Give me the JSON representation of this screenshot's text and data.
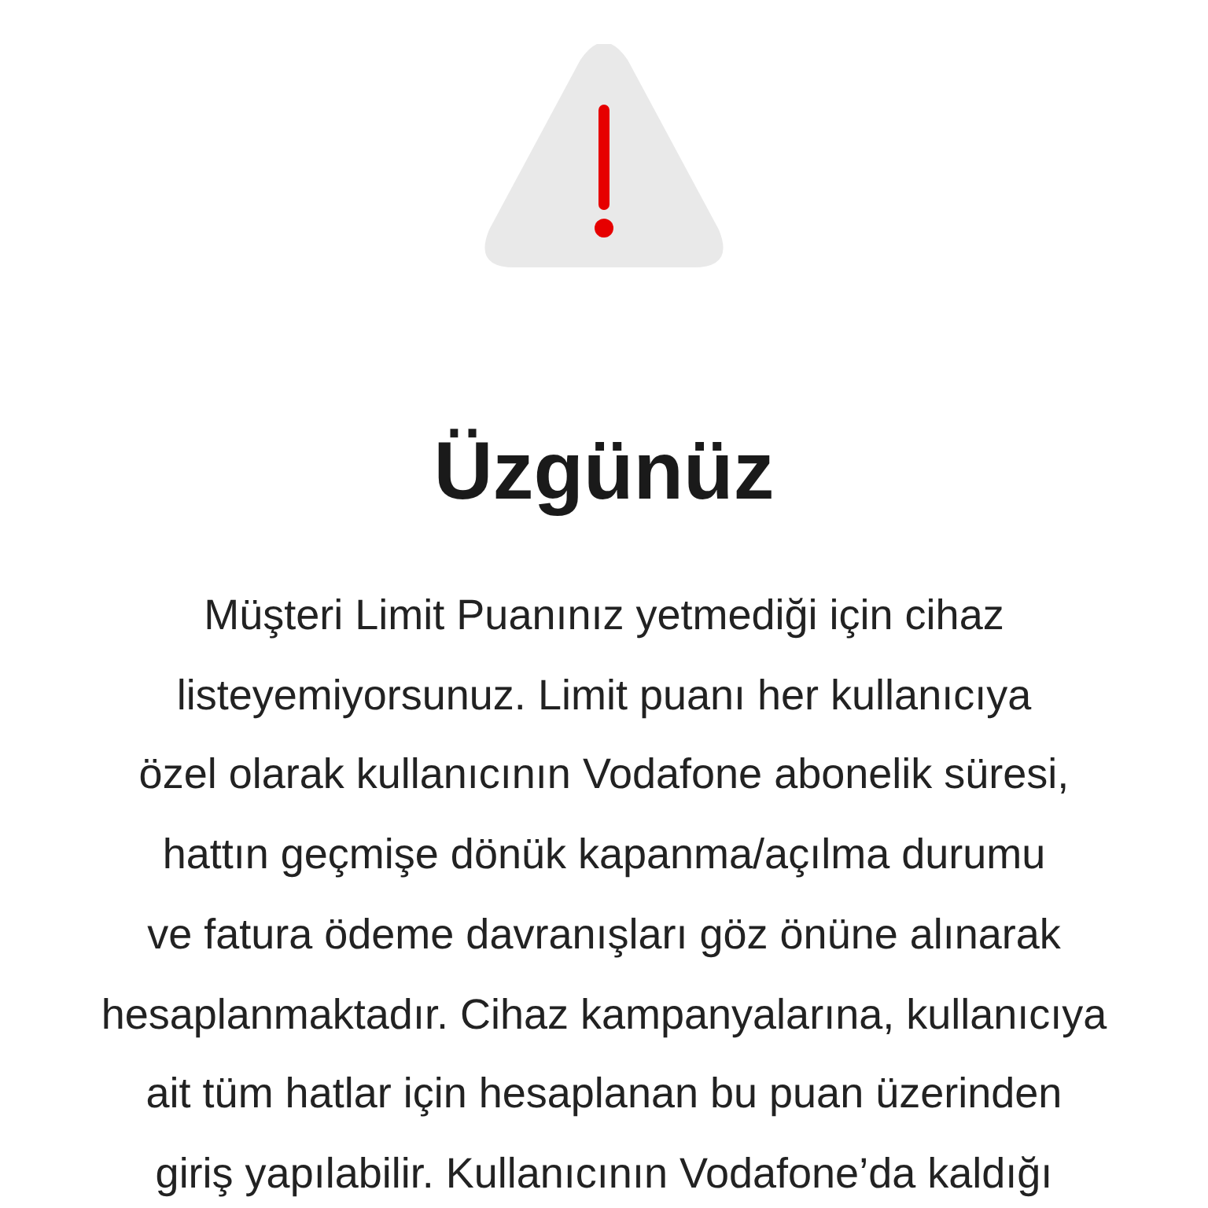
{
  "alert": {
    "title": "Üzgünüz",
    "message_lines": [
      "Müşteri Limit Puanınız yetmediği için cihaz",
      "listeyemiyorsunuz. Limit puanı her kullanıcıya",
      "özel olarak kullanıcının Vodafone abonelik süresi,",
      "hattın geçmişe dönük kapanma/açılma durumu",
      "ve fatura ödeme davranışları göz önüne alınarak",
      "hesaplanmaktadır. Cihaz kampanyalarına, kullanıcıya",
      "ait tüm hatlar için hesaplanan bu puan üzerinden",
      "giriş yapılabilir. Kullanıcının Vodafone’da kaldığı"
    ]
  }
}
